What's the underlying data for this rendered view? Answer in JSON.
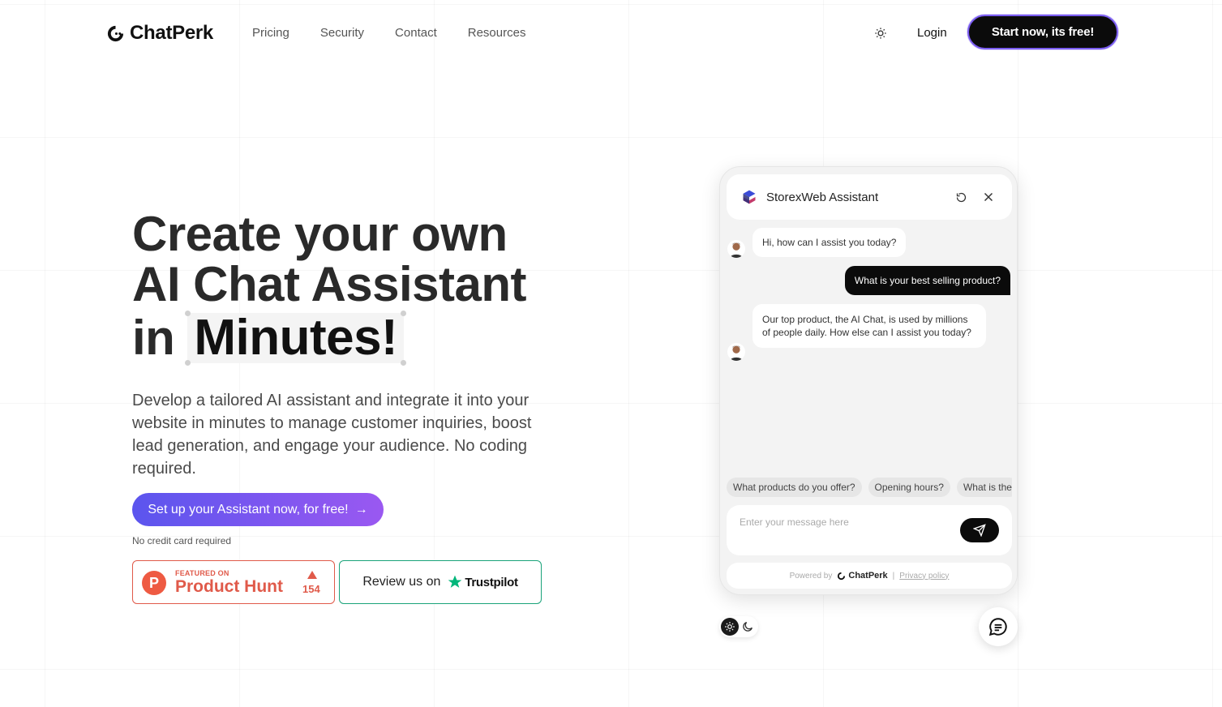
{
  "header": {
    "brand": "ChatPerk",
    "nav": [
      "Pricing",
      "Security",
      "Contact",
      "Resources"
    ],
    "login": "Login",
    "start_cta": "Start now, its free!"
  },
  "hero": {
    "line1": "Create your own",
    "line2": "AI Chat Assistant",
    "line3_prefix": "in",
    "line3_highlight": "Minutes!",
    "description": "Develop a tailored AI assistant and integrate it into your website in minutes to manage customer inquiries, boost lead generation, and engage your audience. No coding required.",
    "cta": "Set up your Assistant now, for free!",
    "cta_arrow": "→",
    "no_credit_card": "No credit card required"
  },
  "badges": {
    "product_hunt": {
      "small": "FEATURED ON",
      "big": "Product Hunt",
      "count": "154",
      "logo_letter": "P"
    },
    "trustpilot": {
      "text": "Review us on",
      "brand": "Trustpilot"
    }
  },
  "chat": {
    "title": "StorexWeb Assistant",
    "messages": {
      "bot1": "Hi, how can I assist you today?",
      "user1": "What is your best selling product?",
      "bot2": "Our top product, the AI Chat, is used by millions of people daily. How else can I assist you today?"
    },
    "suggestions": [
      "What products do you offer?",
      "Opening hours?",
      "What is the"
    ],
    "input_placeholder": "Enter your message here",
    "footer": {
      "powered_by": "Powered by",
      "brand": "ChatPerk",
      "separator": "|",
      "privacy": "Privacy policy"
    }
  },
  "colors": {
    "accent_start": "#5b55ee",
    "accent_end": "#9a58f1",
    "product_hunt": "#e05a4a",
    "trustpilot": "#00b67a"
  }
}
